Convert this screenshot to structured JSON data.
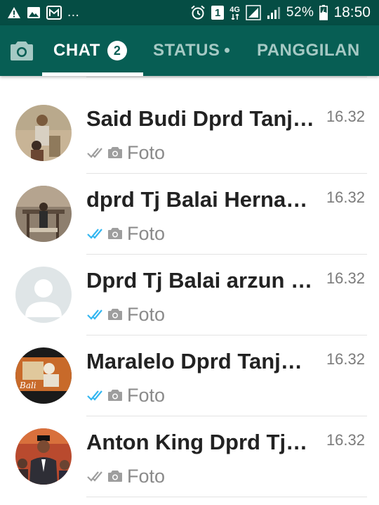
{
  "status_bar": {
    "more": "...",
    "network": "4G",
    "sim": "1",
    "battery": "52%",
    "time": "18:50"
  },
  "tabs": {
    "chat": {
      "label": "CHAT",
      "badge": "2"
    },
    "status": {
      "label": "STATUS"
    },
    "calls": {
      "label": "PANGGILAN"
    }
  },
  "chats": [
    {
      "name": "Said Budi Dprd Tanj…",
      "time": "16.32",
      "preview": "Foto",
      "read": false,
      "avatar": "photo-1"
    },
    {
      "name": "dprd Tj Balai Herna…",
      "time": "16.32",
      "preview": "Foto",
      "read": true,
      "avatar": "photo-2"
    },
    {
      "name": "Dprd Tj Balai arzun l…",
      "time": "16.32",
      "preview": "Foto",
      "read": true,
      "avatar": "default"
    },
    {
      "name": "Maralelo Dprd Tanju…",
      "time": "16.32",
      "preview": "Foto",
      "read": true,
      "avatar": "photo-3"
    },
    {
      "name": "Anton King Dprd Tjb…",
      "time": "16.32",
      "preview": "Foto",
      "read": false,
      "avatar": "photo-4"
    }
  ],
  "colors": {
    "primary": "#075e54",
    "status_bar": "#054d44",
    "read_tick": "#34b7f1",
    "unread_tick": "#9e9e9e"
  }
}
